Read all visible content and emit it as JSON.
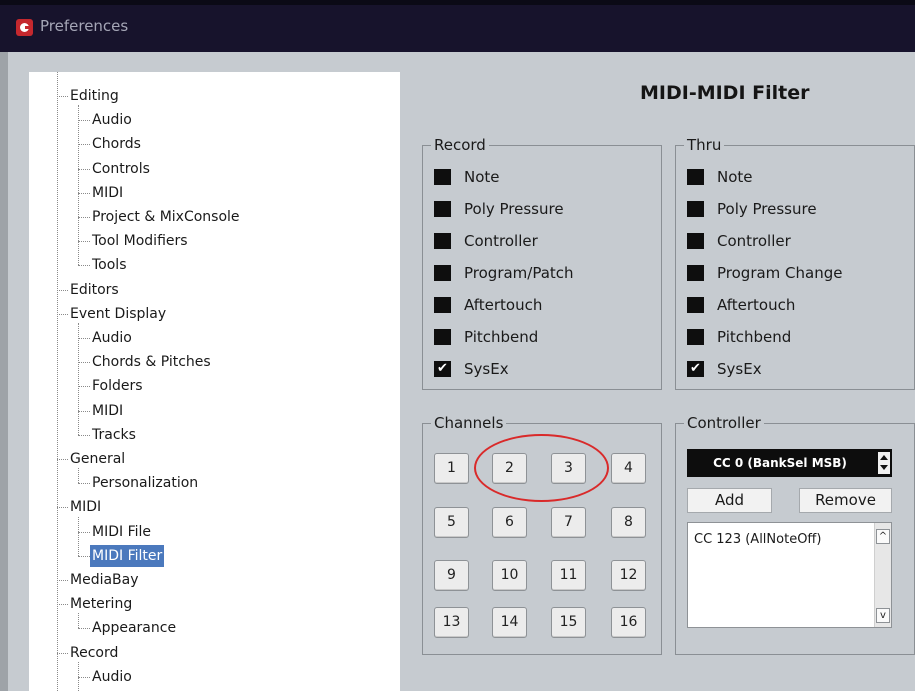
{
  "window": {
    "title": "Preferences",
    "accent": "#c5282e"
  },
  "tree": [
    {
      "label": "Editing",
      "level": 0,
      "selected": false
    },
    {
      "label": "Audio",
      "level": 1,
      "selected": false
    },
    {
      "label": "Chords",
      "level": 1,
      "selected": false
    },
    {
      "label": "Controls",
      "level": 1,
      "selected": false
    },
    {
      "label": "MIDI",
      "level": 1,
      "selected": false
    },
    {
      "label": "Project & MixConsole",
      "level": 1,
      "selected": false
    },
    {
      "label": "Tool Modifiers",
      "level": 1,
      "selected": false
    },
    {
      "label": "Tools",
      "level": 1,
      "selected": false
    },
    {
      "label": "Editors",
      "level": 0,
      "selected": false
    },
    {
      "label": "Event Display",
      "level": 0,
      "selected": false
    },
    {
      "label": "Audio",
      "level": 1,
      "selected": false
    },
    {
      "label": "Chords & Pitches",
      "level": 1,
      "selected": false
    },
    {
      "label": "Folders",
      "level": 1,
      "selected": false
    },
    {
      "label": "MIDI",
      "level": 1,
      "selected": false
    },
    {
      "label": "Tracks",
      "level": 1,
      "selected": false
    },
    {
      "label": "General",
      "level": 0,
      "selected": false
    },
    {
      "label": "Personalization",
      "level": 1,
      "selected": false
    },
    {
      "label": "MIDI",
      "level": 0,
      "selected": false
    },
    {
      "label": "MIDI File",
      "level": 1,
      "selected": false
    },
    {
      "label": "MIDI Filter",
      "level": 1,
      "selected": true
    },
    {
      "label": "MediaBay",
      "level": 0,
      "selected": false
    },
    {
      "label": "Metering",
      "level": 0,
      "selected": false
    },
    {
      "label": "Appearance",
      "level": 1,
      "selected": false
    },
    {
      "label": "Record",
      "level": 0,
      "selected": false
    },
    {
      "label": "Audio",
      "level": 1,
      "selected": false
    }
  ],
  "page": {
    "title": "MIDI-MIDI Filter"
  },
  "record": {
    "title": "Record",
    "items": [
      {
        "label": "Note",
        "checked": false
      },
      {
        "label": "Poly Pressure",
        "checked": false
      },
      {
        "label": "Controller",
        "checked": false
      },
      {
        "label": "Program/Patch",
        "checked": false
      },
      {
        "label": "Aftertouch",
        "checked": false
      },
      {
        "label": "Pitchbend",
        "checked": false
      },
      {
        "label": "SysEx",
        "checked": true
      }
    ]
  },
  "thru": {
    "title": "Thru",
    "items": [
      {
        "label": "Note",
        "checked": false
      },
      {
        "label": "Poly Pressure",
        "checked": false
      },
      {
        "label": "Controller",
        "checked": false
      },
      {
        "label": "Program Change",
        "checked": false
      },
      {
        "label": "Aftertouch",
        "checked": false
      },
      {
        "label": "Pitchbend",
        "checked": false
      },
      {
        "label": "SysEx",
        "checked": true
      }
    ]
  },
  "channels": {
    "title": "Channels",
    "buttons": [
      "1",
      "2",
      "3",
      "4",
      "5",
      "6",
      "7",
      "8",
      "9",
      "10",
      "11",
      "12",
      "13",
      "14",
      "15",
      "16"
    ]
  },
  "controller": {
    "title": "Controller",
    "selected": "CC 0  (BankSel MSB)",
    "add_label": "Add",
    "remove_label": "Remove",
    "list": [
      "CC 123  (AllNoteOff)"
    ],
    "scroll_up_glyph": "^",
    "scroll_down_glyph": "v"
  },
  "annotation": {
    "color": "#d92a2a"
  }
}
